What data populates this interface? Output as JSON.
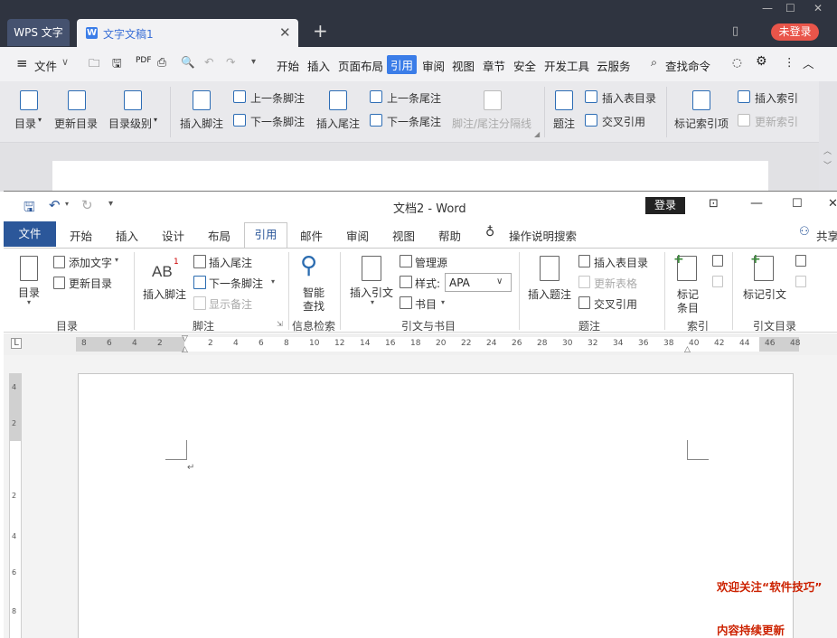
{
  "wps": {
    "app_tab": "WPS 文字",
    "doc_tab": "文字文稿1",
    "login": "未登录",
    "menu": {
      "file": "文件",
      "items": [
        "开始",
        "插入",
        "页面布局",
        "引用",
        "审阅",
        "视图",
        "章节",
        "安全",
        "开发工具",
        "云服务"
      ],
      "active": "引用",
      "search": "查找命令"
    },
    "ribbon": {
      "toc": "目录",
      "update_toc": "更新目录",
      "toc_level": "目录级别",
      "insert_footnote": "插入脚注",
      "prev_footnote": "上一条脚注",
      "next_footnote": "下一条脚注",
      "insert_endnote": "插入尾注",
      "prev_endnote": "上一条尾注",
      "next_endnote": "下一条尾注",
      "separator": "脚注/尾注分隔线",
      "caption": "题注",
      "insert_table_of_figures": "插入表目录",
      "cross_ref": "交叉引用",
      "mark_index": "标记索引项",
      "insert_index": "插入索引",
      "update_index": "更新索引"
    }
  },
  "word": {
    "title": "文档2  -  Word",
    "login": "登录",
    "tabs": {
      "file": "文件",
      "items": [
        "开始",
        "插入",
        "设计",
        "布局",
        "引用",
        "邮件",
        "审阅",
        "视图",
        "帮助"
      ],
      "active": "引用",
      "tell_me": "操作说明搜索",
      "share": "共享"
    },
    "ribbon": {
      "toc": "目录",
      "add_text": "添加文字",
      "update_table": "更新目录",
      "group_toc": "目录",
      "insert_footnote": "插入脚注",
      "ab_label": "AB",
      "ab_sup": "1",
      "insert_endnote": "插入尾注",
      "next_footnote": "下一条脚注",
      "show_notes": "显示备注",
      "group_footnotes": "脚注",
      "smart_lookup_1": "智能",
      "smart_lookup_2": "查找",
      "group_research": "信息检索",
      "insert_citation": "插入引文",
      "manage_sources": "管理源",
      "style_label": "样式:",
      "style_value": "APA",
      "bibliography": "书目",
      "group_citations": "引文与书目",
      "insert_caption": "插入题注",
      "insert_tof": "插入表目录",
      "update_tof": "更新表格",
      "cross_ref": "交叉引用",
      "group_captions": "题注",
      "mark_entry_1": "标记",
      "mark_entry_2": "条目",
      "group_index": "索引",
      "mark_citation": "标记引文",
      "group_toa": "引文目录"
    },
    "ruler_ticks": [
      "8",
      "6",
      "4",
      "2",
      "2",
      "4",
      "6",
      "8",
      "10",
      "12",
      "14",
      "16",
      "18",
      "20",
      "22",
      "24",
      "26",
      "28",
      "30",
      "32",
      "34",
      "36",
      "38",
      "40",
      "42",
      "44",
      "46",
      "48"
    ],
    "vruler_ticks": [
      "4",
      "2",
      "2",
      "4",
      "6",
      "8"
    ]
  },
  "overlay": {
    "line1": "欢迎关注“软件技巧”",
    "line2": "内容持续更新"
  },
  "colors": {
    "wps_titlebar": "#2f3440",
    "wps_accent": "#3b7de8",
    "wps_login": "#e9554a",
    "word_accent": "#2b579a",
    "overlay_text": "#cc2200"
  }
}
